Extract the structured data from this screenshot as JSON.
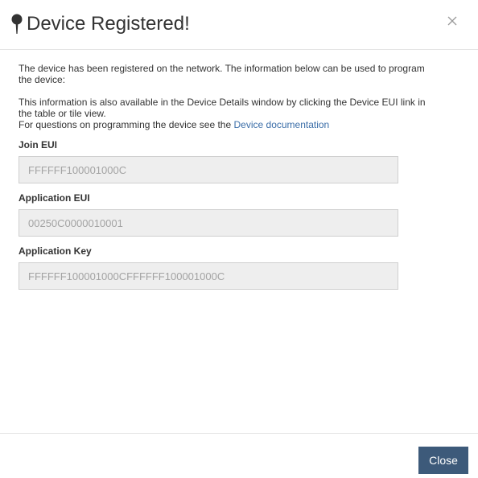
{
  "dialog": {
    "title": "Device Registered!",
    "title_icon": "map-pin-icon",
    "close_icon": "close-icon"
  },
  "body": {
    "intro_line": "The device has been registered on the network. The information below can be used to program the device:",
    "info_line": "This information is also available in the Device Details window by clicking the Device EUI link in the table or tile view.",
    "questions_prefix": "For questions on programming the device see the",
    "doc_link_text": "Device documentation"
  },
  "fields": {
    "join_eui": {
      "label": "Join EUI",
      "value": "FFFFFF100001000C"
    },
    "application_eui": {
      "label": "Application EUI",
      "value": "00250C0000010001"
    },
    "application_key": {
      "label": "Application Key",
      "value": "FFFFFF100001000CFFFFFF100001000C"
    }
  },
  "footer": {
    "close_label": "Close"
  },
  "colors": {
    "primary_button": "#3d5a7a",
    "link": "#3b6ea8",
    "input_bg": "#eeeeee"
  }
}
